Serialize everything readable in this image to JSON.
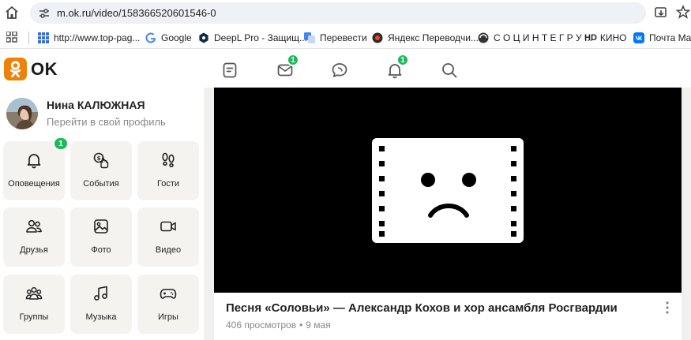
{
  "browser": {
    "url": "m.ok.ru/video/158366520601546-0",
    "bookmarks": [
      {
        "label": "http://www.top-pag...",
        "icon": "grid-favicon-icon"
      },
      {
        "label": "Google",
        "icon": "google-favicon-icon"
      },
      {
        "label": "DeepL Pro - Защищ...",
        "icon": "deepl-favicon-icon"
      },
      {
        "label": "Перевести",
        "icon": "translate-favicon-icon"
      },
      {
        "label": "Яндекс Переводчи...",
        "icon": "yandex-favicon-icon"
      },
      {
        "label": "С О Ц И Н Т Е Г Р У ...",
        "icon": "socintegrum-favicon-icon"
      },
      {
        "label": "КИНО",
        "prefix": "HD",
        "icon": "hd-favicon-icon"
      },
      {
        "label": "Почта Mail.",
        "icon": "vk-favicon-icon"
      }
    ]
  },
  "header": {
    "logo_text": "OK",
    "messages_badge": "1",
    "notifications_badge": "1"
  },
  "profile": {
    "name": "Нина КАЛЮЖНАЯ",
    "subtitle": "Перейти в свой профиль"
  },
  "tiles": [
    {
      "label": "Оповещения",
      "icon": "bell-icon",
      "badge": "1"
    },
    {
      "label": "События",
      "icon": "coins-icon"
    },
    {
      "label": "Гости",
      "icon": "footprints-icon"
    },
    {
      "label": "Друзья",
      "icon": "friends-icon"
    },
    {
      "label": "Фото",
      "icon": "photo-icon"
    },
    {
      "label": "Видео",
      "icon": "video-camera-icon"
    },
    {
      "label": "Группы",
      "icon": "groups-icon"
    },
    {
      "label": "Музыка",
      "icon": "music-note-icon"
    },
    {
      "label": "Игры",
      "icon": "gamepad-icon"
    }
  ],
  "video": {
    "title": "Песня «Соловьи» — Александр Кохов и хор ансамбля Росгвардии",
    "views": "406 просмотров",
    "separator": "•",
    "date": "9 мая"
  },
  "colors": {
    "ok_orange": "#ee8208",
    "badge_green": "#1fb959",
    "tile_bg": "#f5f3f0"
  }
}
